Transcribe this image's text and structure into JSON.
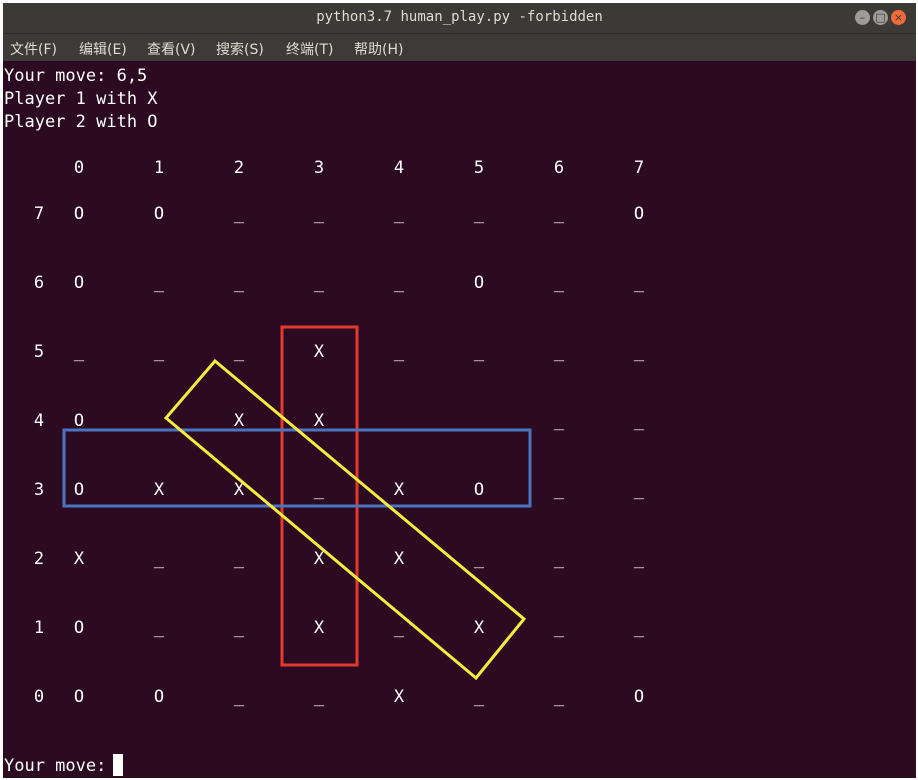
{
  "window": {
    "title": "python3.7 human_play.py -forbidden",
    "controls": {
      "minimize": "–",
      "maximize": "□",
      "close": "×"
    }
  },
  "menu": [
    {
      "label": "文件(F)"
    },
    {
      "label": "编辑(E)"
    },
    {
      "label": "查看(V)"
    },
    {
      "label": "搜索(S)"
    },
    {
      "label": "终端(T)"
    },
    {
      "label": "帮助(H)"
    }
  ],
  "terminal": {
    "lines": [
      "Your move: 6,5",
      "Player 1 with X",
      "Player 2 with O"
    ],
    "prompt": "Your move: ",
    "board": {
      "col_labels": [
        "0",
        "1",
        "2",
        "3",
        "4",
        "5",
        "6",
        "7"
      ],
      "rows": [
        {
          "label": "7",
          "cells": [
            "O",
            "O",
            "_",
            "_",
            "_",
            "_",
            "_",
            "O"
          ]
        },
        {
          "label": "6",
          "cells": [
            "O",
            "_",
            "_",
            "_",
            "_",
            "O",
            "_",
            "_"
          ]
        },
        {
          "label": "5",
          "cells": [
            "_",
            "_",
            "_",
            "X",
            "_",
            "_",
            "_",
            "_"
          ]
        },
        {
          "label": "4",
          "cells": [
            "O",
            "_",
            "X",
            "X",
            "_",
            "_",
            "_",
            "_"
          ]
        },
        {
          "label": "3",
          "cells": [
            "O",
            "X",
            "X",
            "_",
            "X",
            "O",
            "_",
            "_"
          ]
        },
        {
          "label": "2",
          "cells": [
            "X",
            "_",
            "_",
            "X",
            "X",
            "_",
            "_",
            "_"
          ]
        },
        {
          "label": "1",
          "cells": [
            "O",
            "_",
            "_",
            "X",
            "_",
            "X",
            "_",
            "_"
          ]
        },
        {
          "label": "0",
          "cells": [
            "O",
            "O",
            "_",
            "_",
            "X",
            "_",
            "_",
            "O"
          ]
        }
      ]
    }
  },
  "annotations": {
    "colors": {
      "red": "#e23b2e",
      "blue": "#4a73c2",
      "yellow": "#f5ec3d"
    }
  }
}
